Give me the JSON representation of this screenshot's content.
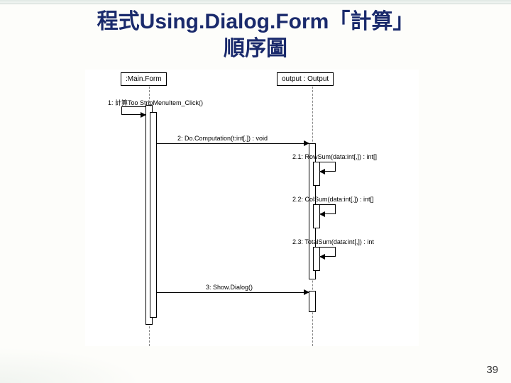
{
  "slide": {
    "title_line1": "程式Using.Dialog.Form「計算」",
    "title_line2": "順序圖",
    "page_number": "39"
  },
  "sequence": {
    "participants": {
      "mainform": ":Main.Form",
      "output": "output : Output"
    },
    "messages": {
      "m1": "1: 計算Too StripMenuItem_Click()",
      "m2": "2: Do.Computation(t:int[,]) : void",
      "m2_1": "2.1: RowSum(data:int[,]) : int[]",
      "m2_2": "2.2: ColSum(data:int[,]) : int[]",
      "m2_3": "2.3: TotalSum(data:int[,]) : int",
      "m3": "3: Show.Dialog()"
    }
  }
}
